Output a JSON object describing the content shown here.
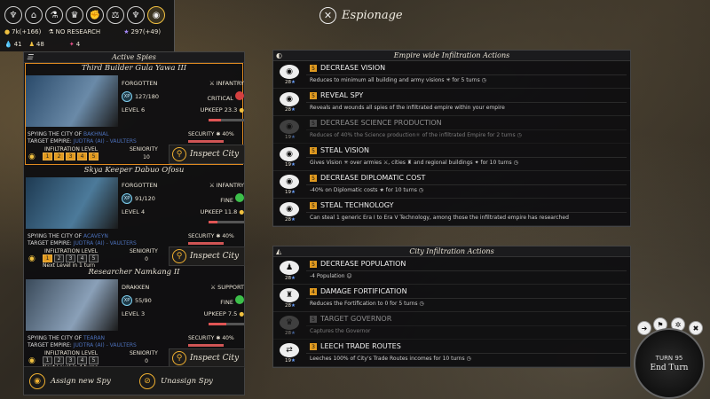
{
  "title": "Espionage",
  "top_icons": [
    "empire-icon",
    "city-icon",
    "science-icon",
    "trophy-icon",
    "fist-icon",
    "diplomacy-icon",
    "handshake-icon",
    "espionage-icon"
  ],
  "resources": {
    "gold": "7k(+166)",
    "research": "NO RESEARCH",
    "influence": "297(+49)",
    "water": "41",
    "population": "48",
    "military": "4"
  },
  "left_panel": {
    "header": "Active Spies",
    "assign_label": "Assign new Spy",
    "unassign_label": "Unassign Spy"
  },
  "spies": [
    {
      "name": "Third Builder Gula Yawa III",
      "status": "FORGOTTEN",
      "role": "INFANTRY",
      "xp": "127/180",
      "health": "CRITICAL",
      "level": "LEVEL 6",
      "upkeep": "UPKEEP 23.3",
      "spying_prefix": "SPYING THE CITY OF",
      "city": "BAKHNAL",
      "target_prefix": "TARGET EMPIRE:",
      "target": "JUDTRA (AI) - VAULTERS",
      "security": "SECURITY",
      "security_val": "40%",
      "infiltration_label": "INFILTRATION LEVEL",
      "seniority_label": "SENIORITY",
      "seniority": "10",
      "levels": [
        "1",
        "2",
        "3",
        "4",
        "5"
      ],
      "level_on": 5,
      "next": "",
      "inspect": "Inspect City",
      "heart_color": "#d44040",
      "bar_pct": 0.35
    },
    {
      "name": "Skya Keeper Dabuo Ofosu",
      "status": "FORGOTTEN",
      "role": "INFANTRY",
      "xp": "91/120",
      "health": "FINE",
      "level": "LEVEL 4",
      "upkeep": "UPKEEP 11.8",
      "spying_prefix": "SPYING THE CITY OF",
      "city": "ACAVEYN",
      "target_prefix": "TARGET EMPIRE:",
      "target": "JUDTRA (AI) - VAULTERS",
      "security": "SECURITY",
      "security_val": "40%",
      "infiltration_label": "INFILTRATION LEVEL",
      "seniority_label": "SENIORITY",
      "seniority": "0",
      "levels": [
        "1",
        "2",
        "3",
        "4",
        "5"
      ],
      "level_on": 1,
      "next": "Next Level in 1 turn",
      "inspect": "Inspect City",
      "heart_color": "#3cbf4a",
      "bar_pct": 0.25
    },
    {
      "name": "Researcher Namkang II",
      "status": "DRAKKEN",
      "role": "SUPPORT",
      "xp": "55/90",
      "health": "FINE",
      "level": "LEVEL 3",
      "upkeep": "UPKEEP 7.5",
      "spying_prefix": "SPYING THE CITY OF",
      "city": "TEARAN",
      "target_prefix": "TARGET EMPIRE:",
      "target": "JUDTRA (AI) - VAULTERS",
      "security": "SECURITY",
      "security_val": "40%",
      "infiltration_label": "INFILTRATION LEVEL",
      "seniority_label": "SENIORITY",
      "seniority": "0",
      "levels": [
        "1",
        "2",
        "3",
        "4",
        "5"
      ],
      "level_on": 0,
      "next": "Next Level in 4 turns",
      "inspect": "Inspect City",
      "heart_color": "#3cbf4a",
      "bar_pct": 0.5
    }
  ],
  "empire_panel": {
    "header": "Empire wide Infiltration Actions",
    "actions": [
      {
        "icon": "eye-icon",
        "level": "5",
        "title": "DECREASE VISION",
        "desc": "Reduces to minimum all building and army visions ✳ for 5 turns ◷",
        "cost": "28",
        "disabled": false
      },
      {
        "icon": "eye-icon",
        "level": "5",
        "title": "REVEAL SPY",
        "desc": "Reveals and wounds all spies of the infiltrated empire within your empire",
        "cost": "28",
        "disabled": false
      },
      {
        "icon": "eye-icon",
        "level": "5",
        "title": "DECREASE SCIENCE PRODUCTION",
        "desc": "Reduces of 40% the Science production⚛ of the infiltrated Empire for 2 turns ◷",
        "cost": "19",
        "disabled": true
      },
      {
        "icon": "eye-icon",
        "level": "5",
        "title": "STEAL VISION",
        "desc": "Gives Vision ✳ over armies ⚔, cities ♜ and regional buildings ✦ for 10 turns ◷",
        "cost": "19",
        "disabled": false
      },
      {
        "icon": "eye-icon",
        "level": "5",
        "title": "DECREASE DIPLOMATIC COST",
        "desc": "-40% on Diplomatic costs ★ for 10 turns ◷",
        "cost": "19",
        "disabled": false
      },
      {
        "icon": "eye-icon",
        "level": "5",
        "title": "STEAL TECHNOLOGY",
        "desc": "Can steal 1 generic Era I to Era V Technology, among those the infiltrated empire has researched",
        "cost": "28",
        "disabled": false
      }
    ]
  },
  "city_panel": {
    "header": "City Infiltration Actions",
    "actions": [
      {
        "icon": "population-icon",
        "level": "5",
        "title": "DECREASE POPULATION",
        "desc": "-4 Population ☺",
        "cost": "28",
        "disabled": false
      },
      {
        "icon": "fortification-icon",
        "level": "4",
        "title": "DAMAGE FORTIFICATION",
        "desc": "Reduces the Fortification to 0 for 5 turns ◷",
        "cost": "28",
        "disabled": false
      },
      {
        "icon": "crown-icon",
        "level": "5",
        "title": "TARGET GOVERNOR",
        "desc": "Captures the Governor",
        "cost": "28",
        "disabled": true
      },
      {
        "icon": "trade-icon",
        "level": "3",
        "title": "LEECH TRADE ROUTES",
        "desc": "Leeches 100% of City's Trade Routes incomes for 10 turns ◷",
        "cost": "19",
        "disabled": false
      }
    ]
  },
  "endturn": {
    "turn": "TURN 95",
    "label": "End Turn"
  }
}
